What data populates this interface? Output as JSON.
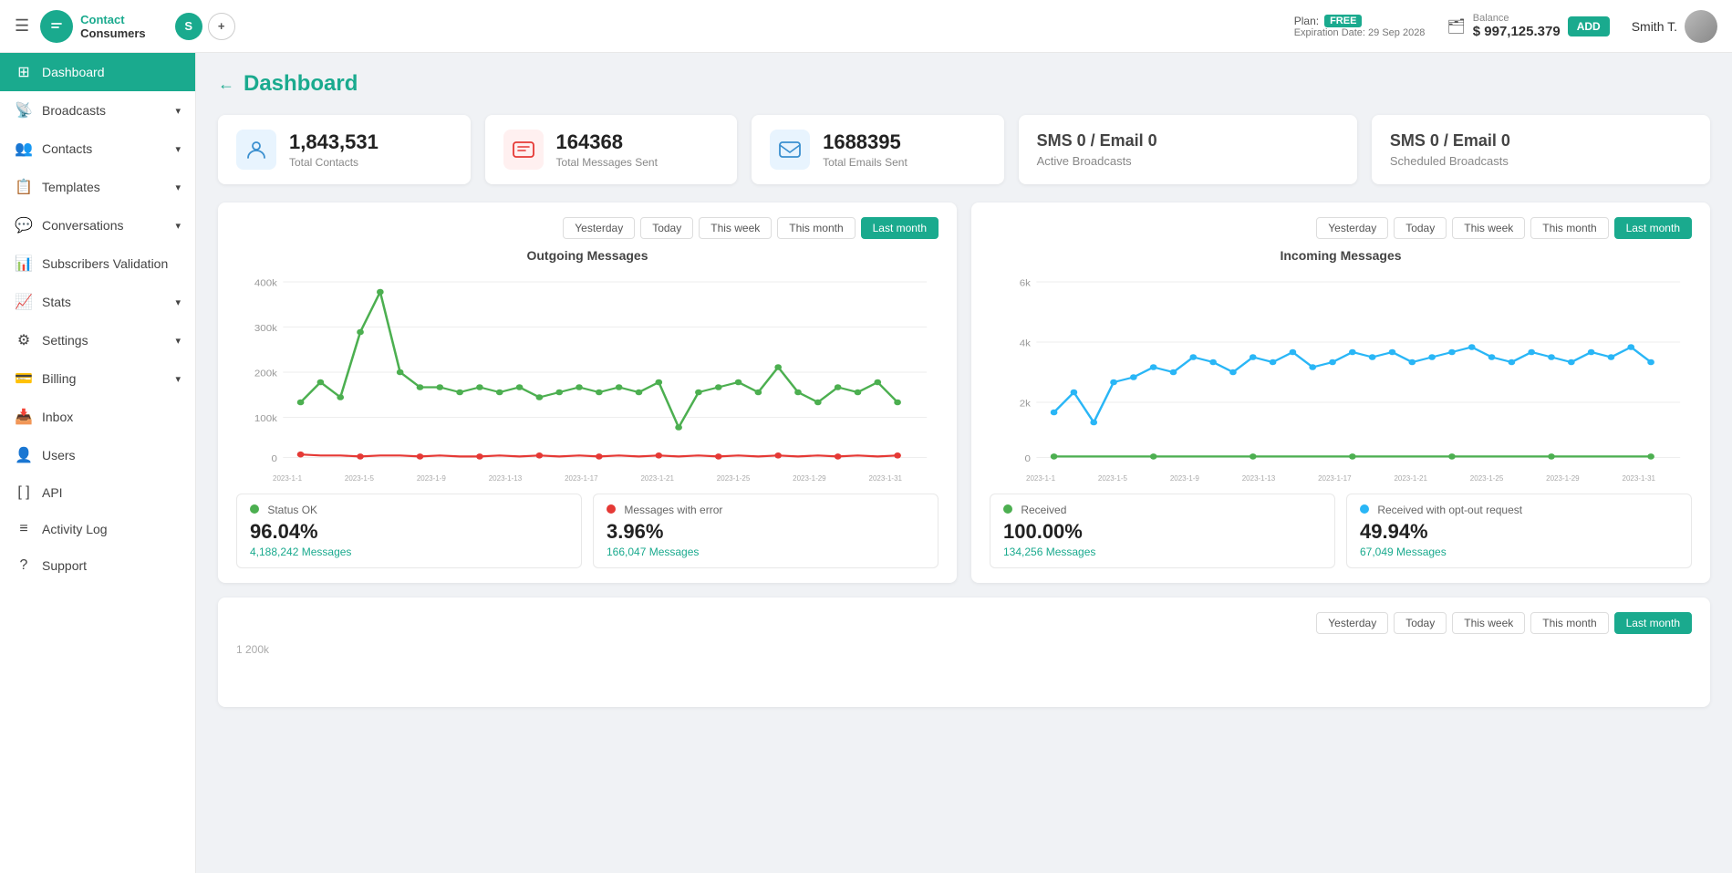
{
  "topbar": {
    "hamburger": "☰",
    "logo_icon": "💬",
    "logo_line1": "Contact",
    "logo_line2": "Consumers",
    "workspace_initial": "S",
    "workspace_add": "+",
    "plan_label": "Plan:",
    "plan_badge": "FREE",
    "expiry_label": "Expiration Date: 29 Sep 2028",
    "balance_label": "Balance",
    "balance_amount": "$ 997,125.379",
    "add_btn": "ADD",
    "user_name": "Smith T."
  },
  "sidebar": {
    "items": [
      {
        "id": "dashboard",
        "icon": "⊞",
        "label": "Dashboard",
        "active": true,
        "arrow": ""
      },
      {
        "id": "broadcasts",
        "icon": "📡",
        "label": "Broadcasts",
        "active": false,
        "arrow": "▾"
      },
      {
        "id": "contacts",
        "icon": "👥",
        "label": "Contacts",
        "active": false,
        "arrow": "▾"
      },
      {
        "id": "templates",
        "icon": "📋",
        "label": "Templates",
        "active": false,
        "arrow": "▾"
      },
      {
        "id": "conversations",
        "icon": "💬",
        "label": "Conversations",
        "active": false,
        "arrow": "▾"
      },
      {
        "id": "subscribers",
        "icon": "📊",
        "label": "Subscribers Validation",
        "active": false,
        "arrow": ""
      },
      {
        "id": "stats",
        "icon": "📈",
        "label": "Stats",
        "active": false,
        "arrow": "▾"
      },
      {
        "id": "settings",
        "icon": "⚙",
        "label": "Settings",
        "active": false,
        "arrow": "▾"
      },
      {
        "id": "billing",
        "icon": "💳",
        "label": "Billing",
        "active": false,
        "arrow": "▾"
      },
      {
        "id": "inbox",
        "icon": "📥",
        "label": "Inbox",
        "active": false,
        "arrow": ""
      },
      {
        "id": "users",
        "icon": "👤",
        "label": "Users",
        "active": false,
        "arrow": ""
      },
      {
        "id": "api",
        "icon": "[ ]",
        "label": "API",
        "active": false,
        "arrow": ""
      },
      {
        "id": "activity",
        "icon": "≡",
        "label": "Activity Log",
        "active": false,
        "arrow": ""
      },
      {
        "id": "support",
        "icon": "?",
        "label": "Support",
        "active": false,
        "arrow": ""
      }
    ]
  },
  "page": {
    "title": "Dashboard",
    "back": "←"
  },
  "stat_cards": [
    {
      "id": "total-contacts",
      "icon": "👤",
      "icon_class": "icon-contacts",
      "num": "1,843,531",
      "label": "Total Contacts"
    },
    {
      "id": "total-messages",
      "icon": "💬",
      "icon_class": "icon-sms",
      "num": "164368",
      "label": "Total Messages Sent"
    },
    {
      "id": "total-emails",
      "icon": "✉",
      "icon_class": "icon-email",
      "num": "1688395",
      "label": "Total Emails Sent"
    },
    {
      "id": "active-broadcasts",
      "big_label": "SMS 0 / Email 0",
      "sub_label": "Active Broadcasts"
    },
    {
      "id": "scheduled-broadcasts",
      "big_label": "SMS 0 / Email 0",
      "sub_label": "Scheduled Broadcasts"
    }
  ],
  "outgoing_chart": {
    "title": "Outgoing Messages",
    "time_buttons": [
      "Yesterday",
      "Today",
      "This week",
      "This month",
      "Last month"
    ],
    "active_button": "Last month",
    "yaxis": [
      "400k",
      "300k",
      "200k",
      "100k",
      "0"
    ],
    "stats": [
      {
        "dot_color": "#4caf50",
        "label": "Status OK",
        "pct": "96.04%",
        "msgs": "4,188,242 Messages"
      },
      {
        "dot_color": "#e53935",
        "label": "Messages with error",
        "pct": "3.96%",
        "msgs": "166,047 Messages"
      }
    ]
  },
  "incoming_chart": {
    "title": "Incoming Messages",
    "time_buttons": [
      "Yesterday",
      "Today",
      "This week",
      "This month",
      "Last month"
    ],
    "active_button": "Last month",
    "yaxis": [
      "6k",
      "4k",
      "2k",
      "0"
    ],
    "stats": [
      {
        "dot_color": "#4caf50",
        "label": "Received",
        "pct": "100.00%",
        "msgs": "134,256 Messages"
      },
      {
        "dot_color": "#29b6f6",
        "label": "Received with opt-out request",
        "pct": "49.94%",
        "msgs": "67,049 Messages"
      }
    ]
  },
  "bottom_chart": {
    "time_buttons": [
      "Yesterday",
      "Today",
      "This week",
      "This month",
      "Last month"
    ],
    "active_button": "Last month",
    "yaxis_label": "1 200k"
  }
}
